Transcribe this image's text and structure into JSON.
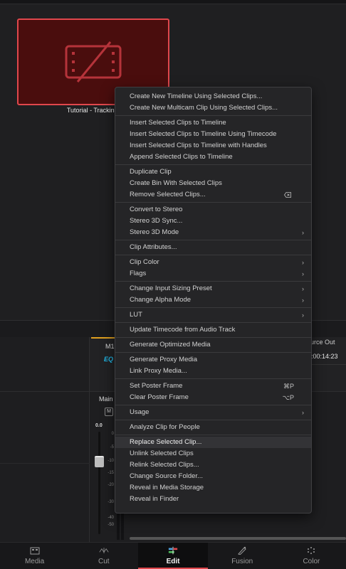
{
  "media_pool": {
    "clip_label": "Tutorial - Tracking.",
    "clip_icon": "missing-media-icon",
    "clip_border_color": "#e0474c"
  },
  "inspector": {
    "tab_label": "M1",
    "eq_label": "EQ",
    "source_out_label": "urce Out",
    "source_out_timecode": ":00:14:23"
  },
  "mixer": {
    "channel_label": "Main",
    "m_button": "M",
    "fader_value": "0.0",
    "db_scale": [
      "0",
      "-5",
      "-10",
      "-15",
      "-20",
      "-30",
      "-40",
      "-50"
    ]
  },
  "page_nav": {
    "tabs": [
      {
        "label": "Media",
        "icon": "media-page-icon",
        "active": false
      },
      {
        "label": "Cut",
        "icon": "cut-page-icon",
        "active": false
      },
      {
        "label": "Edit",
        "icon": "edit-page-icon",
        "active": true
      },
      {
        "label": "Fusion",
        "icon": "fusion-page-icon",
        "active": false
      },
      {
        "label": "Color",
        "icon": "color-page-icon",
        "active": false
      }
    ]
  },
  "context_menu": {
    "groups": [
      [
        {
          "label": "Create New Timeline Using Selected Clips..."
        },
        {
          "label": "Create New Multicam Clip Using Selected Clips..."
        }
      ],
      [
        {
          "label": "Insert Selected Clips to Timeline"
        },
        {
          "label": "Insert Selected Clips to Timeline Using Timecode"
        },
        {
          "label": "Insert Selected Clips to Timeline with Handles"
        },
        {
          "label": "Append Selected Clips to Timeline"
        }
      ],
      [
        {
          "label": "Duplicate Clip"
        },
        {
          "label": "Create Bin With Selected Clips"
        },
        {
          "label": "Remove Selected Clips...",
          "icon": "delete-key-icon"
        }
      ],
      [
        {
          "label": "Convert to Stereo"
        },
        {
          "label": "Stereo 3D Sync..."
        },
        {
          "label": "Stereo 3D Mode",
          "submenu": true
        }
      ],
      [
        {
          "label": "Clip Attributes..."
        }
      ],
      [
        {
          "label": "Clip Color",
          "submenu": true
        },
        {
          "label": "Flags",
          "submenu": true
        }
      ],
      [
        {
          "label": "Change Input Sizing Preset",
          "submenu": true
        },
        {
          "label": "Change Alpha Mode",
          "submenu": true
        }
      ],
      [
        {
          "label": "LUT",
          "submenu": true
        }
      ],
      [
        {
          "label": "Update Timecode from Audio Track"
        }
      ],
      [
        {
          "label": "Generate Optimized Media"
        }
      ],
      [
        {
          "label": "Generate Proxy Media"
        },
        {
          "label": "Link Proxy Media..."
        }
      ],
      [
        {
          "label": "Set Poster Frame",
          "shortcut": "⌘P"
        },
        {
          "label": "Clear Poster Frame",
          "shortcut": "⌥P"
        }
      ],
      [
        {
          "label": "Usage",
          "submenu": true
        }
      ],
      [
        {
          "label": "Analyze Clip for People"
        }
      ],
      [
        {
          "label": "Replace Selected Clip...",
          "highlighted": true
        },
        {
          "label": "Unlink Selected Clips"
        },
        {
          "label": "Relink Selected Clips..."
        },
        {
          "label": "Change Source Folder..."
        },
        {
          "label": "Reveal in Media Storage"
        },
        {
          "label": "Reveal in Finder"
        }
      ]
    ]
  }
}
